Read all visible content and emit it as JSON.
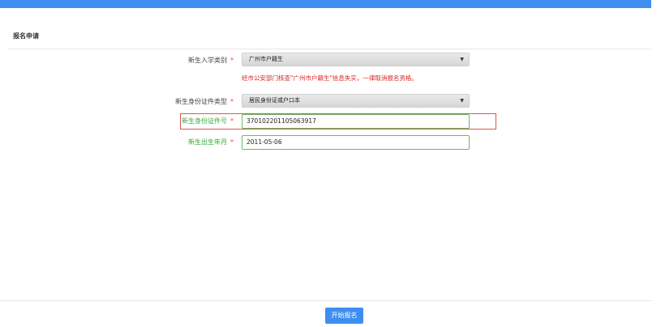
{
  "header": {
    "section_title": "报名申请"
  },
  "form": {
    "admission_type": {
      "label": "新生入学类别",
      "required_mark": "*",
      "selected": "广州市户籍生",
      "warning": "经市公安部门核查\"广州市户籍生\"信息失实，一律取消报名资格。"
    },
    "id_type": {
      "label": "新生身份证件类型",
      "required_mark": "*",
      "selected": "居民身份证或户口本"
    },
    "id_number": {
      "label": "新生身份证件号",
      "required_mark": "*",
      "value": "370102201105063917"
    },
    "birth_month": {
      "label": "新生出生年月",
      "required_mark": "*",
      "value": "2011-05-06"
    }
  },
  "footer": {
    "submit_label": "开始报名"
  },
  "colors": {
    "accent": "#3e8ef0",
    "error": "#e02020",
    "valid": "#66bb66"
  }
}
